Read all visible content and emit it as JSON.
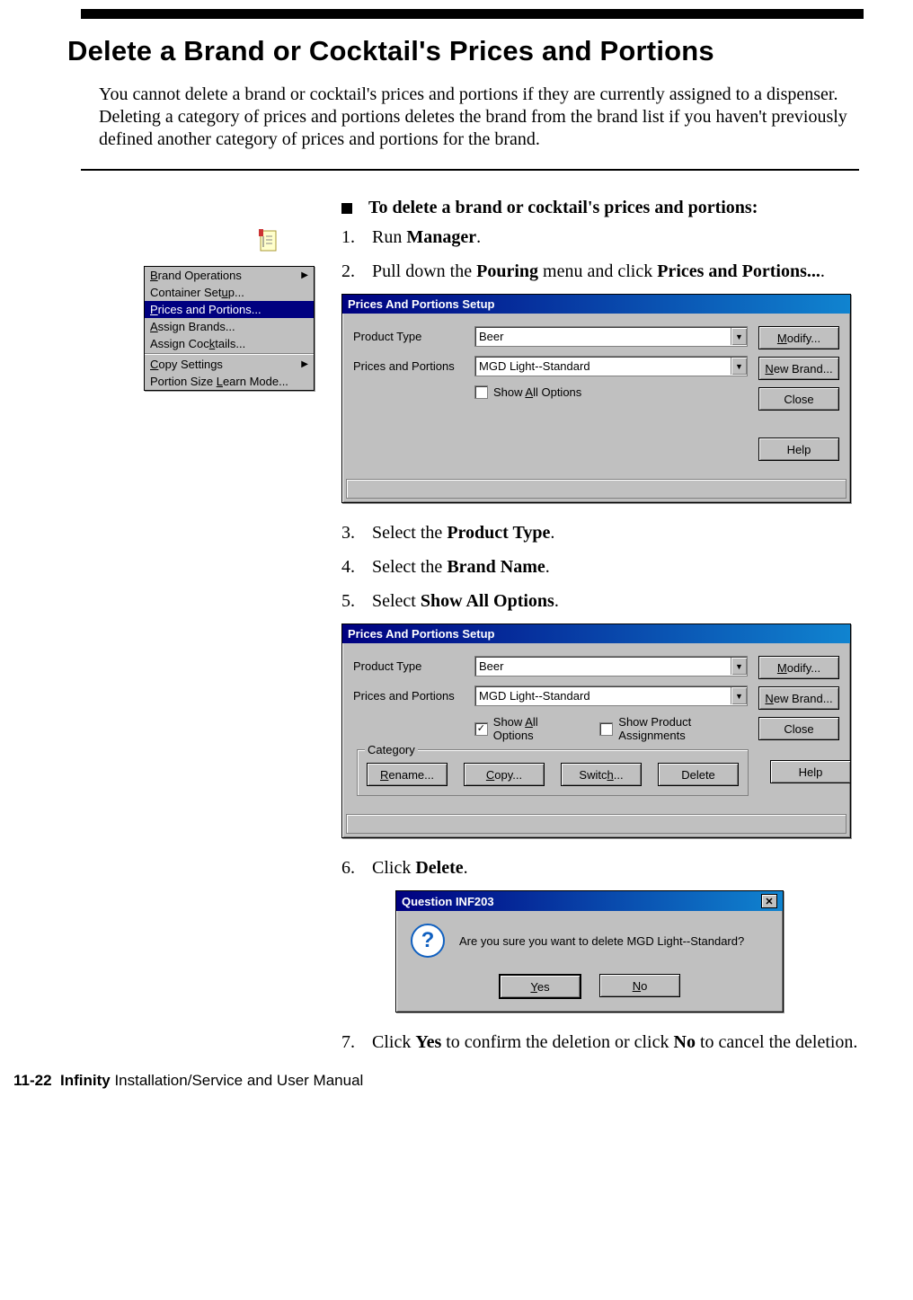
{
  "heading": "Delete a Brand or Cocktail's Prices and Portions",
  "intro": "You cannot delete a brand or cocktail's prices and portions if they are currently assigned to a dispenser. Deleting a category of prices and portions deletes the brand from the brand list if you haven't previously defined another category of prices and portions for the brand.",
  "task_heading": "To delete a brand or cocktail's prices and portions:",
  "menu": {
    "items": [
      {
        "pre": "",
        "u": "B",
        "post": "rand Operations",
        "sub": true
      },
      {
        "pre": "Container Set",
        "u": "u",
        "post": "p..."
      },
      {
        "pre": "",
        "u": "P",
        "post": "rices and Portions...",
        "selected": true
      },
      {
        "pre": "",
        "u": "A",
        "post": "ssign Brands..."
      },
      {
        "pre": "Assign Coc",
        "u": "k",
        "post": "tails..."
      },
      {
        "sep": true
      },
      {
        "pre": "",
        "u": "C",
        "post": "opy Settings",
        "sub": true
      },
      {
        "pre": "Portion Size ",
        "u": "L",
        "post": "earn Mode..."
      }
    ]
  },
  "steps": {
    "s1_pre": "Run ",
    "s1_b": "Manager",
    "s1_post": ".",
    "s2_pre": "Pull down the ",
    "s2_b1": "Pouring",
    "s2_mid": " menu and click ",
    "s2_b2": "Prices and Portions...",
    "s2_post": ".",
    "s3_pre": "Select the ",
    "s3_b": "Product Type",
    "s3_post": ".",
    "s4_pre": "Select the ",
    "s4_b": "Brand Name",
    "s4_post": ".",
    "s5_pre": "Select ",
    "s5_b": "Show All Options",
    "s5_post": ".",
    "s6_pre": "Click ",
    "s6_b": "Delete",
    "s6_post": ".",
    "s7_pre": "Click ",
    "s7_b1": "Yes",
    "s7_mid": " to confirm the deletion or click ",
    "s7_b2": "No",
    "s7_post": " to cancel the deletion."
  },
  "dlg": {
    "title": "Prices And Portions Setup",
    "product_type_label": "Product Type",
    "product_type_value": "Beer",
    "pp_label": "Prices and Portions",
    "pp_value": "MGD Light--Standard",
    "show_all": "Show All Options",
    "show_all_u": "A",
    "show_pa": "Show Product Assignments",
    "btn_modify": "Modify...",
    "btn_modify_u": "M",
    "btn_new": "New Brand...",
    "btn_new_u": "N",
    "btn_close": "Close",
    "btn_help": "Help",
    "category": "Category",
    "btn_rename": "Rename...",
    "btn_rename_u": "R",
    "btn_copy": "Copy...",
    "btn_copy_u": "C",
    "btn_switch": "Switch...",
    "btn_switch_u": "h",
    "btn_delete": "Delete"
  },
  "question": {
    "title": "Question INF203",
    "text": "Are you sure you want to delete MGD Light--Standard?",
    "yes": "Yes",
    "yes_u": "Y",
    "no": "No",
    "no_u": "N"
  },
  "footer_page": "11-22",
  "footer_bold": "Infinity",
  "footer_rest": " Installation/Service and User Manual"
}
